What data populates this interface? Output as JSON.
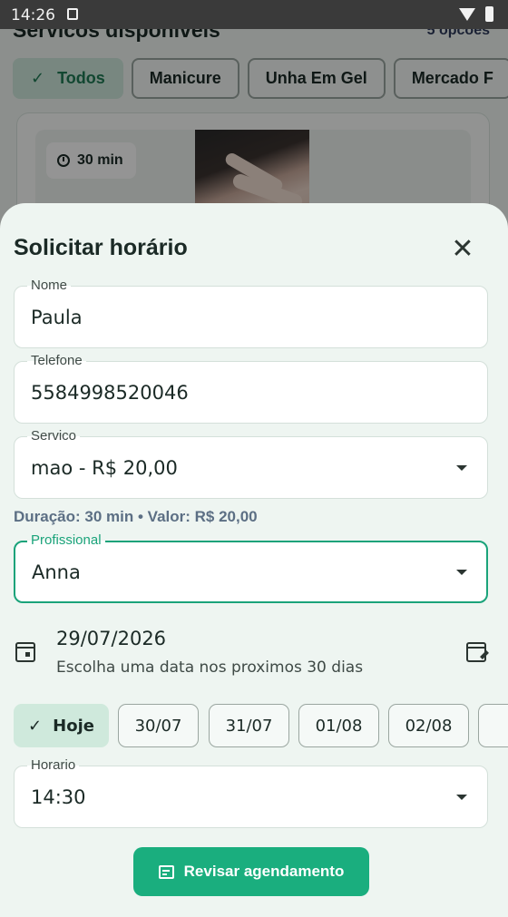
{
  "status_bar": {
    "time": "14:26"
  },
  "background": {
    "title": "Servicos disponiveis",
    "count": "5 opcoes",
    "chips": [
      {
        "label": "Todos",
        "selected": true
      },
      {
        "label": "Manicure",
        "selected": false
      },
      {
        "label": "Unha Em Gel",
        "selected": false
      },
      {
        "label": "Mercado F",
        "selected": false
      }
    ],
    "card": {
      "duration": "30 min"
    }
  },
  "sheet": {
    "title": "Solicitar horário",
    "nome": {
      "label": "Nome",
      "value": "Paula"
    },
    "telefone": {
      "label": "Telefone",
      "value": "5584998520046"
    },
    "servico": {
      "label": "Servico",
      "value": "mao - R$ 20,00"
    },
    "info": "Duração: 30 min • Valor: R$ 20,00",
    "profissional": {
      "label": "Profissional",
      "value": "Anna"
    },
    "date": {
      "value": "29/07/2026",
      "hint": "Escolha uma data nos proximos 30 dias"
    },
    "days": [
      {
        "label": "Hoje",
        "selected": true
      },
      {
        "label": "30/07",
        "selected": false
      },
      {
        "label": "31/07",
        "selected": false
      },
      {
        "label": "01/08",
        "selected": false
      },
      {
        "label": "02/08",
        "selected": false
      }
    ],
    "horario": {
      "label": "Horario",
      "value": "14:30"
    },
    "review_button": "Revisar agendamento"
  },
  "colors": {
    "accent": "#1aae7e",
    "selected_chip": "#cfe9dc",
    "sheet_bg": "#eef5f1"
  }
}
